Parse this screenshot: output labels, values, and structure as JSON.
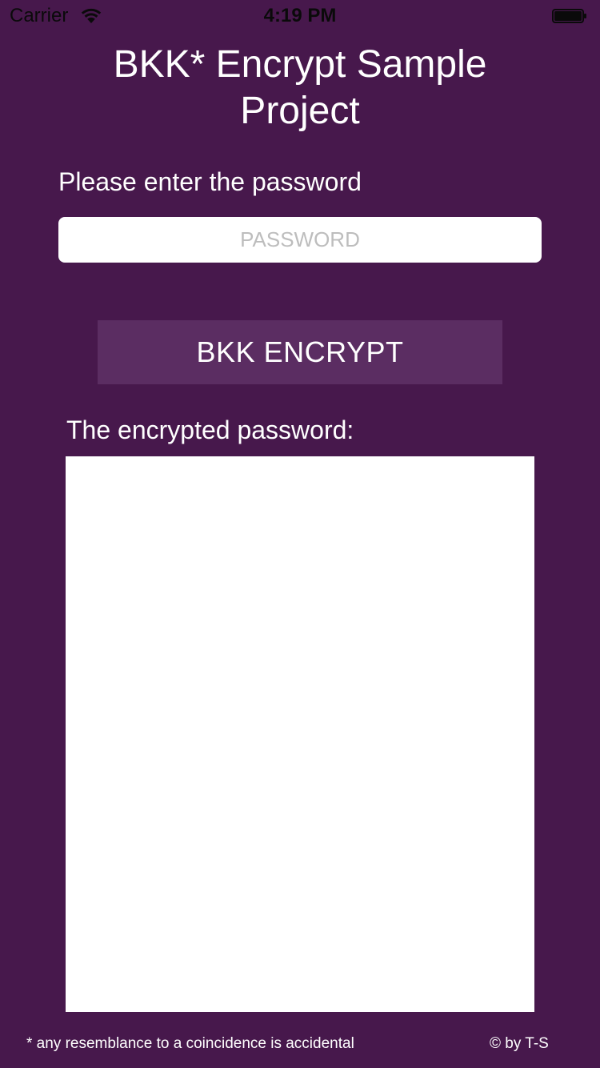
{
  "status_bar": {
    "carrier": "Carrier",
    "time": "4:19 PM",
    "wifi_icon": "wifi-icon",
    "battery_icon": "battery-icon",
    "battery_level": 1.0
  },
  "header": {
    "title": "BKK* Encrypt Sample Project"
  },
  "input_section": {
    "label": "Please enter the password",
    "password": {
      "value": "",
      "placeholder": "PASSWORD"
    }
  },
  "actions": {
    "encrypt_label": "BKK ENCRYPT"
  },
  "result_section": {
    "label": "The encrypted password:",
    "value": ""
  },
  "footer": {
    "note": "* any resemblance to a coincidence is accidental",
    "credit": "© by T-S"
  },
  "colors": {
    "background": "#47184c",
    "button": "#5b2d62",
    "field": "#ffffff",
    "placeholder": "#bdbdbd"
  }
}
